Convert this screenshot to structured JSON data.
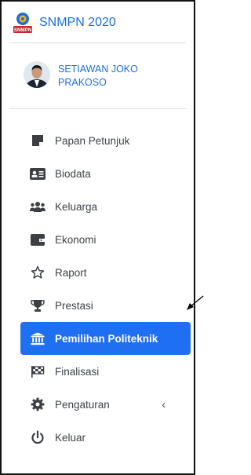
{
  "brand": {
    "title": "SNMPN 2020",
    "logo_text": "SNMPN"
  },
  "user": {
    "name": "SETIAWAN JOKO PRAKOSO"
  },
  "menu": [
    {
      "label": "Papan Petunjuk",
      "icon": "note-icon"
    },
    {
      "label": "Biodata",
      "icon": "id-card-icon"
    },
    {
      "label": "Keluarga",
      "icon": "users-icon"
    },
    {
      "label": "Ekonomi",
      "icon": "wallet-icon"
    },
    {
      "label": "Raport",
      "icon": "star-icon"
    },
    {
      "label": "Prestasi",
      "icon": "trophy-icon"
    },
    {
      "label": "Pemilihan Politeknik",
      "icon": "university-icon",
      "active": true
    },
    {
      "label": "Finalisasi",
      "icon": "flag-checkered-icon"
    },
    {
      "label": "Pengaturan",
      "icon": "gear-icon",
      "has_submenu": true
    },
    {
      "label": "Keluar",
      "icon": "power-icon"
    }
  ],
  "colors": {
    "accent": "#1f6ff2",
    "brand_text": "#1a6fe0",
    "text": "#3d4246"
  }
}
